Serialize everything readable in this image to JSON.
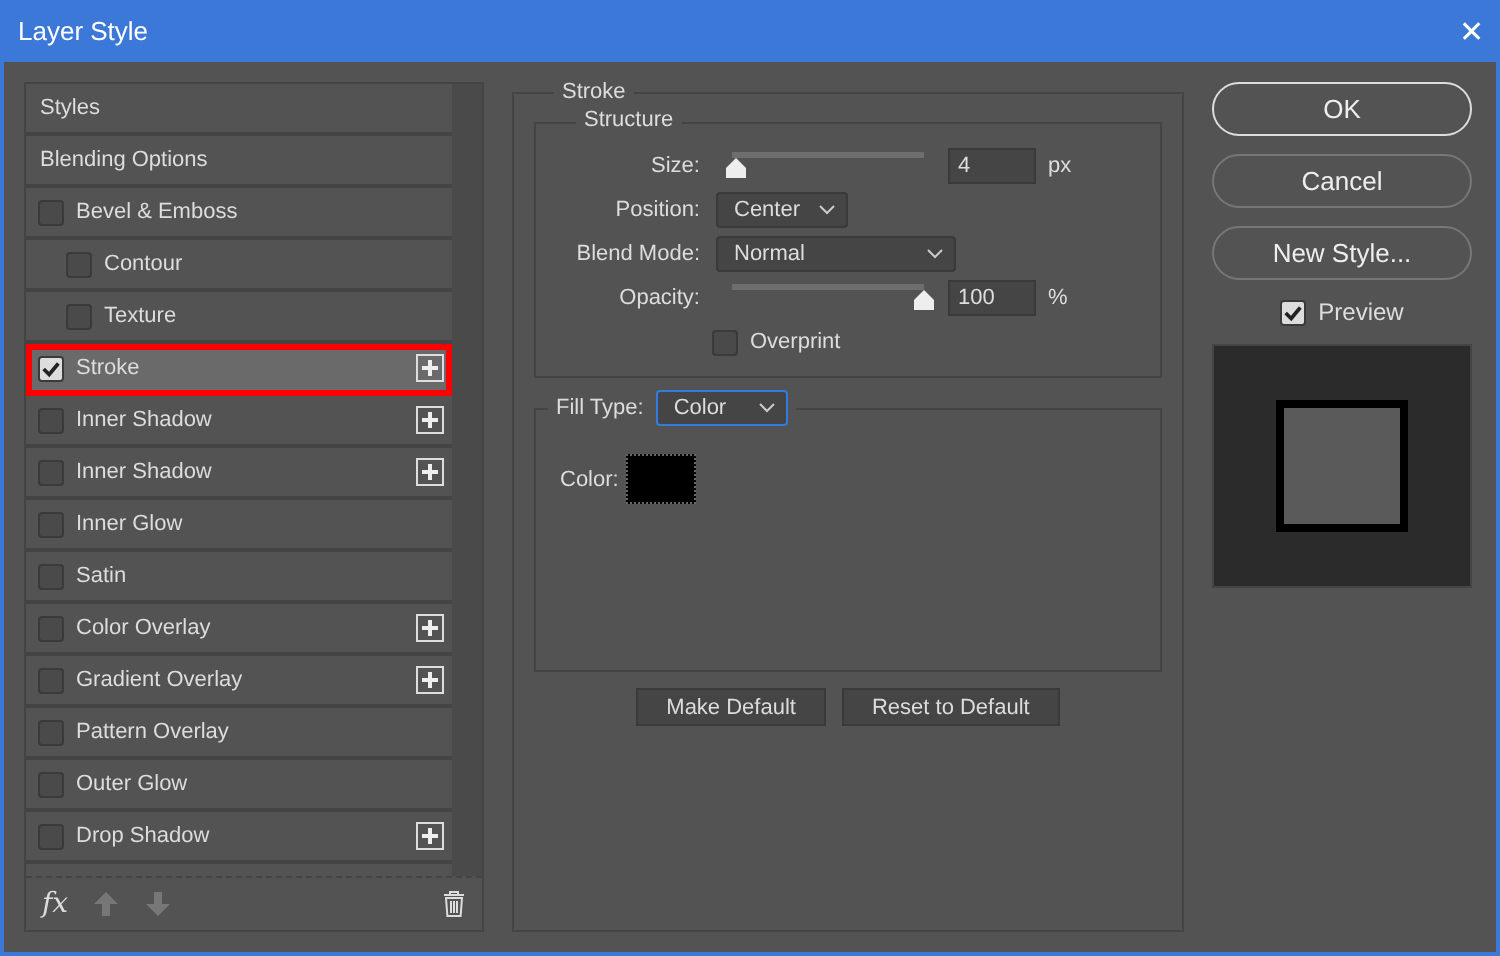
{
  "window": {
    "title": "Layer Style",
    "close": "✕"
  },
  "effects": [
    {
      "kind": "header",
      "label": "Styles"
    },
    {
      "kind": "header",
      "label": "Blending Options"
    },
    {
      "kind": "effect",
      "label": "Bevel & Emboss",
      "checked": false,
      "selected": false,
      "addable": false,
      "children": [
        {
          "kind": "effect",
          "label": "Contour",
          "checked": false,
          "selected": false,
          "addable": false
        },
        {
          "kind": "effect",
          "label": "Texture",
          "checked": false,
          "selected": false,
          "addable": false
        }
      ]
    },
    {
      "kind": "effect",
      "label": "Stroke",
      "checked": true,
      "selected": true,
      "addable": true
    },
    {
      "kind": "effect",
      "label": "Inner Shadow",
      "checked": false,
      "selected": false,
      "addable": true
    },
    {
      "kind": "effect",
      "label": "Inner Shadow",
      "checked": false,
      "selected": false,
      "addable": true
    },
    {
      "kind": "effect",
      "label": "Inner Glow",
      "checked": false,
      "selected": false,
      "addable": false
    },
    {
      "kind": "effect",
      "label": "Satin",
      "checked": false,
      "selected": false,
      "addable": false
    },
    {
      "kind": "effect",
      "label": "Color Overlay",
      "checked": false,
      "selected": false,
      "addable": true
    },
    {
      "kind": "effect",
      "label": "Gradient Overlay",
      "checked": false,
      "selected": false,
      "addable": true
    },
    {
      "kind": "effect",
      "label": "Pattern Overlay",
      "checked": false,
      "selected": false,
      "addable": false
    },
    {
      "kind": "effect",
      "label": "Outer Glow",
      "checked": false,
      "selected": false,
      "addable": false
    },
    {
      "kind": "effect",
      "label": "Drop Shadow",
      "checked": false,
      "selected": false,
      "addable": true
    }
  ],
  "footer": {
    "fx": "fx"
  },
  "stroke": {
    "title": "Stroke",
    "structure": {
      "title": "Structure",
      "size": {
        "label": "Size:",
        "level": 0.02,
        "value": "4",
        "unit": "px"
      },
      "position": {
        "label": "Position:",
        "value": "Center"
      },
      "blend_mode": {
        "label": "Blend Mode:",
        "value": "Normal"
      },
      "opacity": {
        "label": "Opacity:",
        "level": 1,
        "value": "100",
        "unit": "%"
      },
      "overprint": {
        "label": "Overprint",
        "checked": false
      }
    },
    "fill_type": {
      "label": "Fill Type:",
      "value": "Color",
      "color_label": "Color:",
      "color": "#000000"
    },
    "buttons": [
      "Make Default",
      "Reset to Default"
    ]
  },
  "actions": [
    "OK",
    "Cancel",
    "New Style..."
  ],
  "preview": {
    "label": "Preview",
    "checked": true
  }
}
